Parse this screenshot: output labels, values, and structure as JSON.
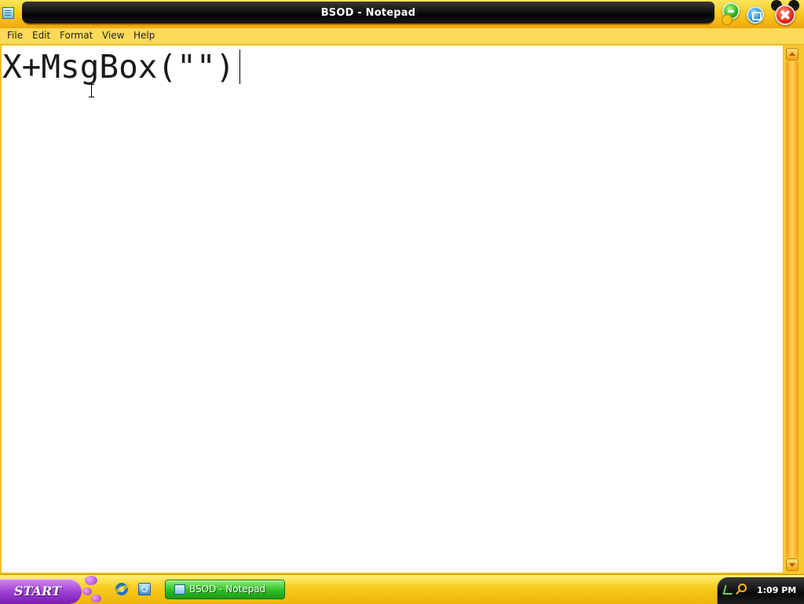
{
  "window": {
    "title": "BSOD - Notepad",
    "icon": "notepad-icon"
  },
  "menu": {
    "items": [
      "File",
      "Edit",
      "Format",
      "View",
      "Help"
    ]
  },
  "editor": {
    "content": "X+MsgBox(\"\")"
  },
  "taskbar": {
    "start_label": "START",
    "quick_launch": [
      "internet-explorer-icon",
      "show-desktop-icon"
    ],
    "task_button_label": "BSOD - Notepad",
    "clock": "1:09 PM"
  },
  "colors": {
    "titlebar_yellow": "#f7c51b",
    "title_pill": "#050505",
    "menubar": "#fcda57",
    "start_purple": "#9a3cd1",
    "task_green": "#2fbf25",
    "tray_black": "#0a0a0a"
  }
}
